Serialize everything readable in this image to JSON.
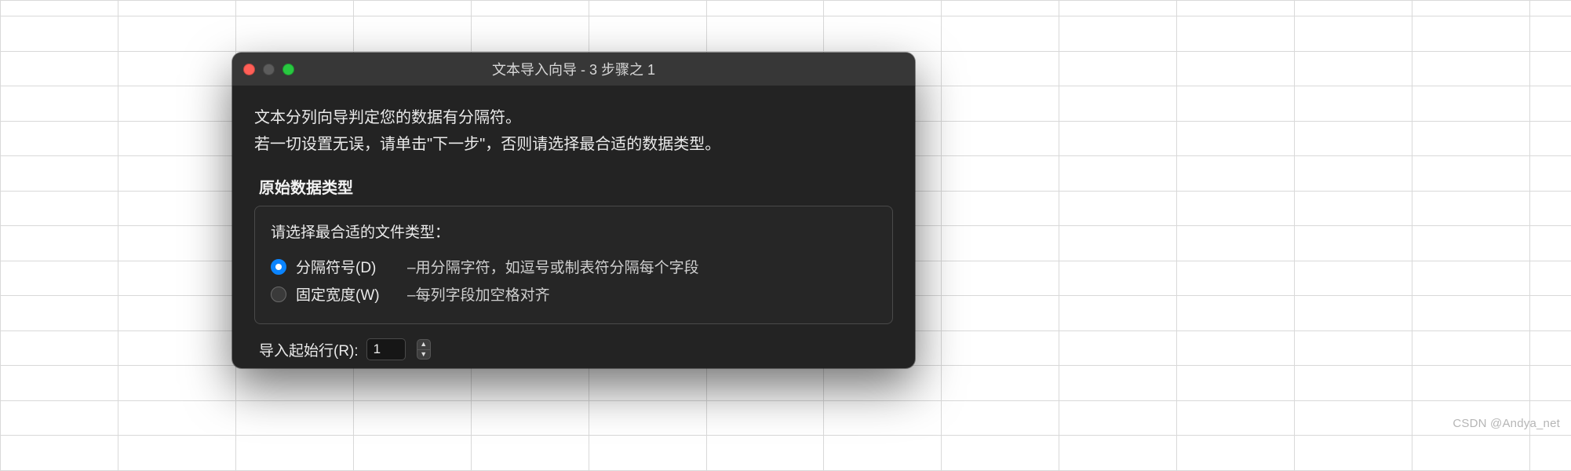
{
  "window": {
    "title": "文本导入向导 - 3 步骤之 1"
  },
  "intro": {
    "line1": "文本分列向导判定您的数据有分隔符。",
    "line2": "若一切设置无误，请单击\"下一步\"，否则请选择最合适的数据类型。"
  },
  "section": {
    "label": "原始数据类型",
    "prompt": "请选择最合适的文件类型：",
    "options": [
      {
        "label": "分隔符号(D)",
        "desc": "–用分隔字符，如逗号或制表符分隔每个字段",
        "checked": true
      },
      {
        "label": "固定宽度(W)",
        "desc": "–每列字段加空格对齐",
        "checked": false
      }
    ]
  },
  "startRow": {
    "label": "导入起始行(R):",
    "value": "1"
  },
  "watermark": "CSDN @Andya_net"
}
